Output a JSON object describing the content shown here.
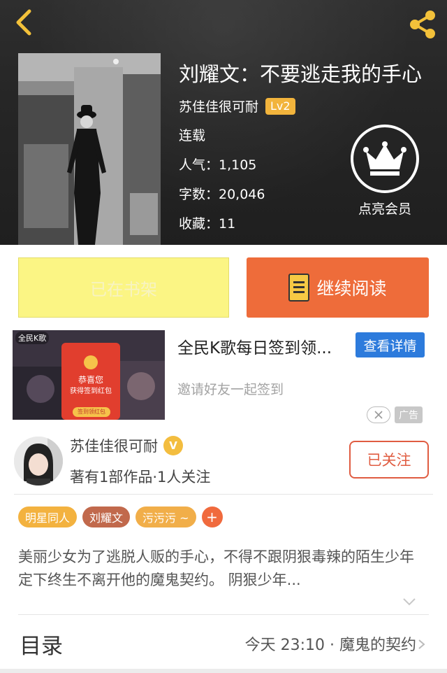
{
  "book": {
    "title": "刘耀文：不要逃走我的手心",
    "author": "苏佳佳很可耐",
    "level": "Lv2",
    "status": "连载",
    "popularity": "人气：1,105",
    "word_count": "字数：20,046",
    "favorites": "收藏：11"
  },
  "vip": {
    "label": "点亮会员"
  },
  "actions": {
    "shelf_label": "已在书架",
    "read_label": "继续阅读"
  },
  "ad": {
    "brand": "全民K歌",
    "title": "全民K歌每日签到领...",
    "detail_button": "查看详情",
    "subtitle": "邀请好友一起签到",
    "tag": "广告",
    "image_text": {
      "line1": "恭喜您",
      "line2": "获得签到红包",
      "button": "签到领红包",
      "currency": "¥"
    }
  },
  "author_card": {
    "name": "苏佳佳很可耐",
    "verified": "V",
    "works": "著有1部作品·1人关注",
    "follow_label": "已关注"
  },
  "tags": [
    {
      "label": "明星同人",
      "color": "#f3b23f"
    },
    {
      "label": "刘耀文",
      "color": "#c1694c"
    },
    {
      "label": "污污污 ~",
      "color": "#f1ae49"
    }
  ],
  "tag_plus": "+",
  "synopsis": "美丽少女为了逃脱人贩的手心，不得不跟阴狠毒辣的陌生少年定下终生不离开他的魔鬼契约。 阴狠少年...",
  "toc": {
    "title": "目录",
    "latest": "今天 23:10 · 魔鬼的契约"
  },
  "colors": {
    "accent": "#ee6c3a",
    "shelf": "#fbf584",
    "link_blue": "#2d7bdc"
  },
  "icons": [
    "back-icon",
    "share-icon",
    "crown-icon",
    "book-icon",
    "close-icon",
    "chevron-down-icon",
    "chevron-right-icon"
  ]
}
